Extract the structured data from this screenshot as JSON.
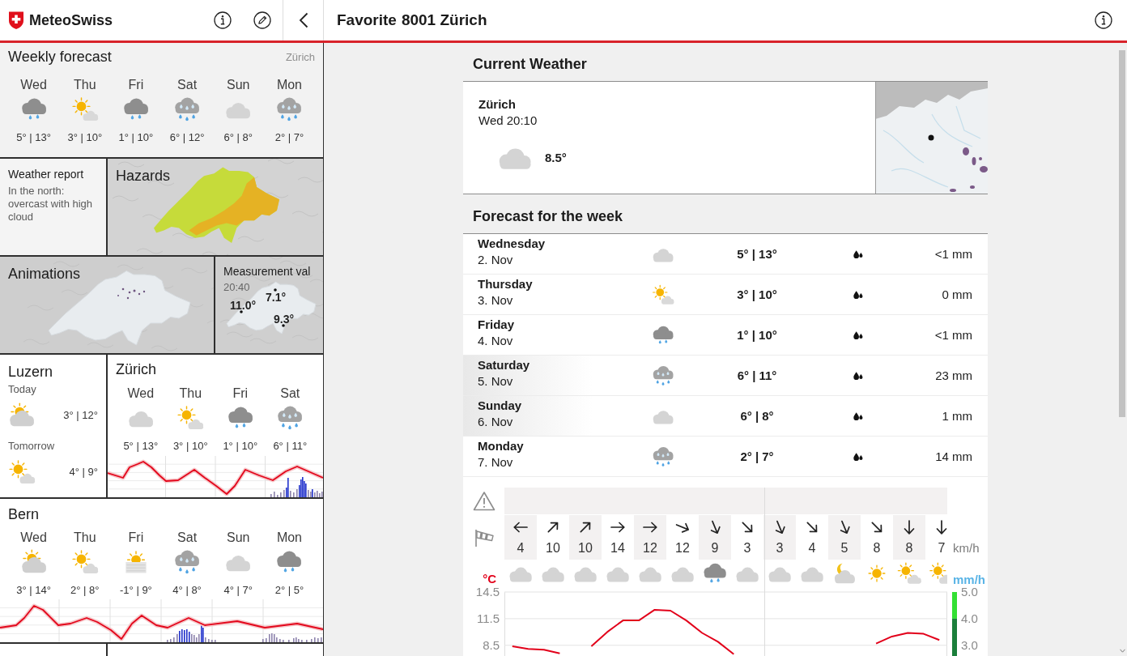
{
  "sidebar": {
    "app_name": "MeteoSwiss",
    "weekly_forecast": {
      "title": "Weekly forecast",
      "location": "Zürich",
      "days": [
        {
          "day": "Wed",
          "kind": "rain",
          "temps": "5° | 13°"
        },
        {
          "day": "Thu",
          "kind": "sunny",
          "temps": "3° | 10°"
        },
        {
          "day": "Fri",
          "kind": "rain",
          "temps": "1° | 10°"
        },
        {
          "day": "Sat",
          "kind": "showers",
          "temps": "6° | 12°"
        },
        {
          "day": "Sun",
          "kind": "cloudy",
          "temps": "6° | 8°"
        },
        {
          "day": "Mon",
          "kind": "showers",
          "temps": "2° | 7°"
        }
      ]
    },
    "weather_report": {
      "title": "Weather report",
      "text": "In the north: overcast with high cloud"
    },
    "hazards": {
      "title": "Hazards"
    },
    "animations": {
      "title": "Animations"
    },
    "measurements": {
      "title": "Measurement val",
      "time": "20:40",
      "readings": [
        "7.1°",
        "11.0°",
        "9.3°"
      ]
    },
    "favorites": [
      {
        "kind": "small",
        "title": "Luzern",
        "periods": [
          {
            "label": "Today",
            "kind": "mostlycloudy",
            "temps": "3° | 12°"
          },
          {
            "label": "Tomorrow",
            "kind": "sunny",
            "temps": "4° | 9°"
          }
        ]
      },
      {
        "kind": "medium",
        "title": "Zürich",
        "days": [
          {
            "day": "Wed",
            "kind": "cloudy",
            "temps": "5° | 13°"
          },
          {
            "day": "Thu",
            "kind": "sunny",
            "temps": "3° | 10°"
          },
          {
            "day": "Fri",
            "kind": "rain",
            "temps": "1° | 10°"
          },
          {
            "day": "Sat",
            "kind": "showers",
            "temps": "6° | 11°"
          }
        ]
      },
      {
        "kind": "wide",
        "title": "Bern",
        "days": [
          {
            "day": "Wed",
            "kind": "mostlycloudy",
            "temps": "3° | 14°"
          },
          {
            "day": "Thu",
            "kind": "sunny",
            "temps": "2° | 8°"
          },
          {
            "day": "Fri",
            "kind": "fog",
            "temps": "-1° | 9°"
          },
          {
            "day": "Sat",
            "kind": "showers",
            "temps": "4° | 8°"
          },
          {
            "day": "Sun",
            "kind": "cloudy",
            "temps": "4° | 7°"
          },
          {
            "day": "Mon",
            "kind": "rain",
            "temps": "2° | 5°"
          }
        ]
      }
    ]
  },
  "main": {
    "header": {
      "label": "Favorite",
      "location": "8001 Zürich"
    },
    "current_weather": {
      "title": "Current Weather",
      "location": "Zürich",
      "time": "Wed 20:10",
      "kind": "cloudy",
      "temperature": "8.5°"
    },
    "week_forecast": {
      "title": "Forecast for the week",
      "days": [
        {
          "day": "Wednesday",
          "date": "2. Nov",
          "kind": "cloudy",
          "temps": "5° | 13°",
          "precipitation": "<1 mm",
          "weekend": false
        },
        {
          "day": "Thursday",
          "date": "3. Nov",
          "kind": "sunny",
          "temps": "3° | 10°",
          "precipitation": "0 mm",
          "weekend": false
        },
        {
          "day": "Friday",
          "date": "4. Nov",
          "kind": "rain",
          "temps": "1° | 10°",
          "precipitation": "<1 mm",
          "weekend": false
        },
        {
          "day": "Saturday",
          "date": "5. Nov",
          "kind": "showers",
          "temps": "6° | 11°",
          "precipitation": "23 mm",
          "weekend": true
        },
        {
          "day": "Sunday",
          "date": "6. Nov",
          "kind": "cloudy",
          "temps": "6° | 8°",
          "precipitation": "1 mm",
          "weekend": true
        },
        {
          "day": "Monday",
          "date": "7. Nov",
          "kind": "showers",
          "temps": "2° | 7°",
          "precipitation": "14 mm",
          "weekend": false
        }
      ]
    },
    "hourly": {
      "wind_unit": "km/h",
      "wind": [
        {
          "kind": "west",
          "speed": "4"
        },
        {
          "kind": "northeast",
          "speed": "10"
        },
        {
          "kind": "northeast",
          "speed": "10"
        },
        {
          "kind": "east",
          "speed": "14"
        },
        {
          "kind": "east",
          "speed": "12"
        },
        {
          "kind": "eastsoutheast",
          "speed": "12"
        },
        {
          "kind": "southsoutheast",
          "speed": "9"
        },
        {
          "kind": "southeast",
          "speed": "3"
        },
        {
          "kind": "southsoutheast",
          "speed": "3"
        },
        {
          "kind": "southeast",
          "speed": "4"
        },
        {
          "kind": "southsoutheast",
          "speed": "5"
        },
        {
          "kind": "southeast",
          "speed": "8"
        },
        {
          "kind": "south",
          "speed": "8"
        },
        {
          "kind": "south",
          "speed": "7"
        }
      ],
      "weather": [
        {
          "kind": "cloudy"
        },
        {
          "kind": "cloudy"
        },
        {
          "kind": "cloudy"
        },
        {
          "kind": "cloudy"
        },
        {
          "kind": "cloudy"
        },
        {
          "kind": "cloudy"
        },
        {
          "kind": "rain"
        },
        {
          "kind": "cloudy"
        },
        {
          "kind": "cloudy"
        },
        {
          "kind": "cloudy"
        },
        {
          "kind": "night"
        },
        {
          "kind": "clear"
        },
        {
          "kind": "sunny"
        },
        {
          "kind": "sunny"
        }
      ],
      "chart_data": {
        "type": "line",
        "ylabel": "°C",
        "y2label": "mm/h",
        "categories": [
          null,
          null,
          null,
          null,
          null,
          null,
          null,
          null,
          null,
          null,
          null,
          null,
          null,
          null,
          null,
          null,
          null,
          null,
          null,
          null,
          null,
          null,
          null,
          null,
          null,
          null,
          null,
          null
        ],
        "values": [
          8.4,
          8.1,
          8.0,
          7.6,
          null,
          8.4,
          10.0,
          11.3,
          11.3,
          12.5,
          12.4,
          11.3,
          9.9,
          8.9,
          7.5,
          null,
          null,
          null,
          null,
          null,
          null,
          null,
          null,
          8.7,
          9.5,
          9.9,
          9.8,
          9.1
        ],
        "color": "#e2001a",
        "ylim": [
          7.3,
          14.5
        ],
        "yticks": [
          8.5,
          11.5,
          14.5
        ],
        "y2lim": [
          2.6,
          5.0
        ],
        "y2ticks": [
          {
            "value": 3,
            "label": "3.0"
          },
          {
            "value": 4,
            "label": "4.0"
          },
          {
            "value": 5,
            "label": "5.0"
          }
        ],
        "grid": true
      }
    }
  }
}
